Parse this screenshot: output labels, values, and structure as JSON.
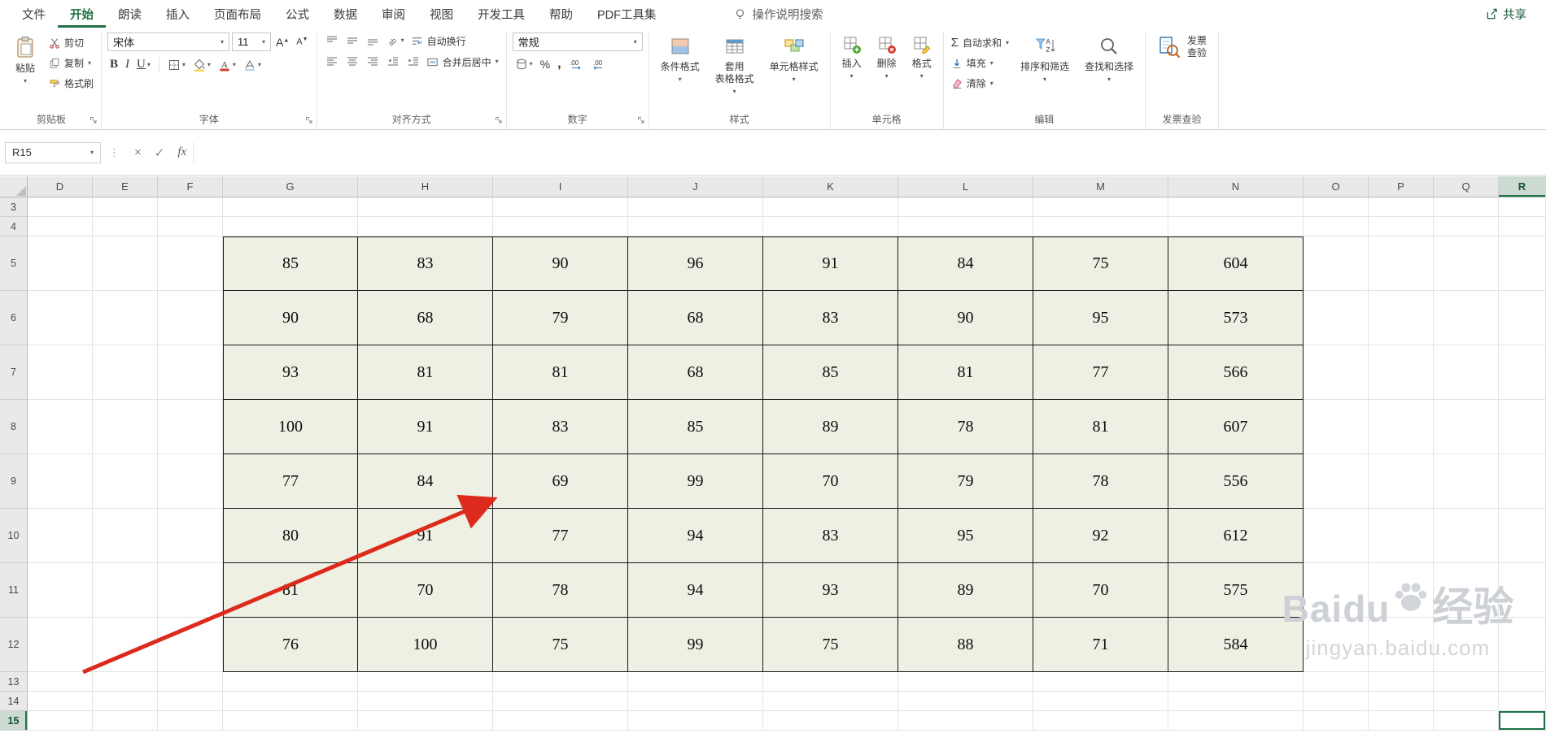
{
  "title_bar": {
    "search_label": "操作说明搜索",
    "share_label": "共享"
  },
  "menu_tabs": [
    {
      "label": "文件",
      "active": false
    },
    {
      "label": "开始",
      "active": true
    },
    {
      "label": "朗读",
      "active": false
    },
    {
      "label": "插入",
      "active": false
    },
    {
      "label": "页面布局",
      "active": false
    },
    {
      "label": "公式",
      "active": false
    },
    {
      "label": "数据",
      "active": false
    },
    {
      "label": "审阅",
      "active": false
    },
    {
      "label": "视图",
      "active": false
    },
    {
      "label": "开发工具",
      "active": false
    },
    {
      "label": "帮助",
      "active": false
    },
    {
      "label": "PDF工具集",
      "active": false
    }
  ],
  "ribbon": {
    "clipboard": {
      "group_label": "剪贴板",
      "paste": "粘贴",
      "cut": "剪切",
      "copy": "复制",
      "format_painter": "格式刷"
    },
    "font": {
      "group_label": "字体",
      "font_name": "宋体",
      "font_size": "11"
    },
    "alignment": {
      "group_label": "对齐方式",
      "wrap_text": "自动换行",
      "merge_center": "合并后居中"
    },
    "number": {
      "group_label": "数字",
      "number_format": "常规"
    },
    "styles": {
      "group_label": "样式",
      "conditional": "条件格式",
      "table_format_line1": "套用",
      "table_format_line2": "表格格式",
      "cell_styles": "单元格样式"
    },
    "cells": {
      "group_label": "单元格",
      "insert": "插入",
      "delete": "删除",
      "format": "格式"
    },
    "editing": {
      "group_label": "编辑",
      "autosum": "自动求和",
      "fill": "填充",
      "clear": "清除",
      "sort_filter": "排序和筛选",
      "find_select": "查找和选择"
    },
    "invoice": {
      "group_label": "发票查验",
      "button_line1": "发票",
      "button_line2": "查验"
    }
  },
  "formula_bar": {
    "name_box_value": "R15",
    "formula_value": ""
  },
  "sheet": {
    "columns": [
      "D",
      "E",
      "F",
      "G",
      "H",
      "I",
      "J",
      "K",
      "L",
      "M",
      "N",
      "O",
      "P",
      "Q",
      "R"
    ],
    "rows": [
      3,
      4,
      5,
      6,
      7,
      8,
      9,
      10,
      11,
      12,
      13,
      14,
      15
    ],
    "selected_cell": "R15",
    "selected_column": "R",
    "selected_row": 15,
    "table": {
      "columns": [
        "G",
        "H",
        "I",
        "J",
        "K",
        "L",
        "M",
        "N"
      ],
      "first_row": 5,
      "values": [
        [
          "85",
          "83",
          "90",
          "96",
          "91",
          "84",
          "75",
          "604"
        ],
        [
          "90",
          "68",
          "79",
          "68",
          "83",
          "90",
          "95",
          "573"
        ],
        [
          "93",
          "81",
          "81",
          "68",
          "85",
          "81",
          "77",
          "566"
        ],
        [
          "100",
          "91",
          "83",
          "85",
          "89",
          "78",
          "81",
          "607"
        ],
        [
          "77",
          "84",
          "69",
          "99",
          "70",
          "79",
          "78",
          "556"
        ],
        [
          "80",
          "91",
          "77",
          "94",
          "83",
          "95",
          "92",
          "612"
        ],
        [
          "81",
          "70",
          "78",
          "94",
          "93",
          "89",
          "70",
          "575"
        ],
        [
          "76",
          "100",
          "75",
          "99",
          "75",
          "88",
          "71",
          "584"
        ]
      ]
    }
  },
  "annotations": {
    "arrow_color": "#dc2a1c"
  },
  "watermark": {
    "brand": "Baidu",
    "brand_suffix": "经验",
    "url": "jingyan.baidu.com"
  },
  "colors": {
    "accent": "#217346",
    "table_fill": "#edf0e2",
    "header_selected": "#ccdad1"
  }
}
